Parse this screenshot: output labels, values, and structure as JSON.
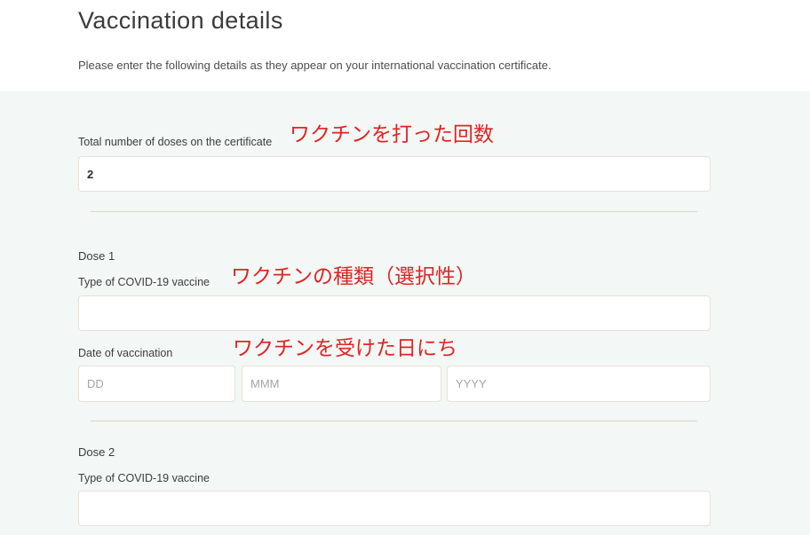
{
  "header": {
    "title": "Vaccination details",
    "subtitle": "Please enter the following details as they appear on your international vaccination certificate."
  },
  "form": {
    "total_doses": {
      "label": "Total number of doses on the certificate",
      "value": "2",
      "annotation": "ワクチンを打った回数"
    },
    "dose1": {
      "heading": "Dose 1",
      "vaccine_type_label": "Type of COVID-19 vaccine",
      "vaccine_type_annotation": "ワクチンの種類（選択性）",
      "vaccine_type_value": "",
      "date_label": "Date of vaccination",
      "date_annotation": "ワクチンを受けた日にち",
      "date_day_placeholder": "DD",
      "date_month_placeholder": "MMM",
      "date_year_placeholder": "YYYY"
    },
    "dose2": {
      "heading": "Dose 2",
      "vaccine_type_label": "Type of COVID-19 vaccine",
      "vaccine_type_value": ""
    }
  },
  "colors": {
    "section_bg": "#f3f7f5",
    "input_border": "#e8e0d4",
    "divider": "#ddd5c6",
    "annotation_red": "#e02424"
  }
}
